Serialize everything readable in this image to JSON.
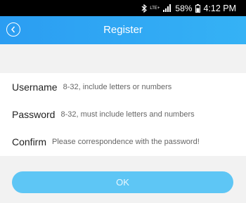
{
  "status_bar": {
    "network": "LTE+",
    "battery": "58%",
    "time": "4:12 PM"
  },
  "header": {
    "title": "Register"
  },
  "form": {
    "username": {
      "label": "Username",
      "placeholder": "8-32, include letters or numbers"
    },
    "password": {
      "label": "Password",
      "placeholder": "8-32, must include letters and numbers"
    },
    "confirm": {
      "label": "Confirm",
      "placeholder": "Please correspondence with the password!"
    }
  },
  "ok_label": "OK",
  "colors": {
    "header": "#2b9df2",
    "button": "#5ec6f5",
    "background": "#f2f2f2"
  }
}
